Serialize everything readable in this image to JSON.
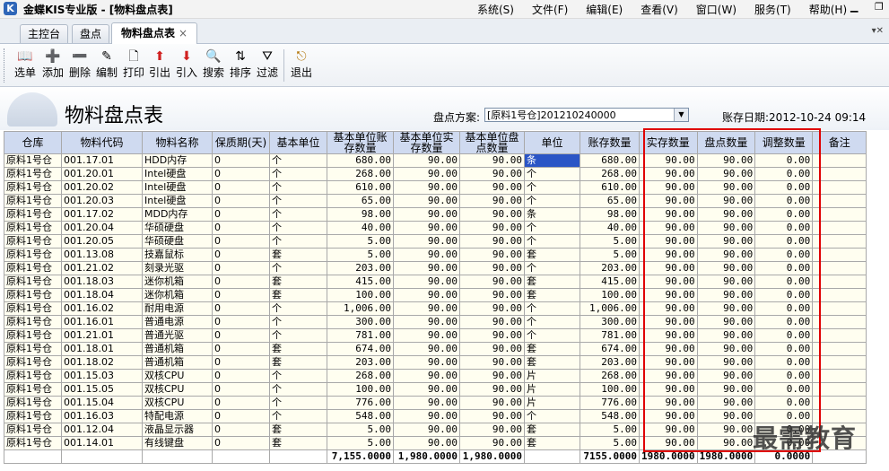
{
  "window": {
    "title": "金蝶KIS专业版 - [物料盘点表]",
    "logo": "K"
  },
  "menu": [
    "系统(S)",
    "文件(F)",
    "编辑(E)",
    "查看(V)",
    "窗口(W)",
    "服务(T)",
    "帮助(H)"
  ],
  "tabs": [
    {
      "label": "主控台"
    },
    {
      "label": "盘点"
    },
    {
      "label": "物料盘点表",
      "close": "×"
    }
  ],
  "toolbar": [
    {
      "label": "选单",
      "icon": "book-icon",
      "glyph": "📖"
    },
    {
      "label": "添加",
      "icon": "add-icon",
      "glyph": "➕"
    },
    {
      "label": "删除",
      "icon": "delete-icon",
      "glyph": "➖"
    },
    {
      "label": "编制",
      "icon": "edit-icon",
      "glyph": "✎"
    },
    {
      "label": "打印",
      "icon": "print-icon",
      "glyph": "🗋"
    },
    {
      "label": "引出",
      "icon": "export-icon",
      "glyph": "⬆"
    },
    {
      "label": "引入",
      "icon": "import-icon",
      "glyph": "⬇"
    },
    {
      "label": "搜索",
      "icon": "search-icon",
      "glyph": "🔍"
    },
    {
      "label": "排序",
      "icon": "sort-icon",
      "glyph": "⇅"
    },
    {
      "label": "过滤",
      "icon": "filter-icon",
      "glyph": "⛛"
    },
    {
      "label": "退出",
      "icon": "exit-icon",
      "glyph": "⎋"
    }
  ],
  "page": {
    "title": "物料盘点表",
    "plan_label": "盘点方案:",
    "plan_value": "[原料1号仓]201210240000",
    "date_label": "账存日期:",
    "date_value": "2012-10-24 09:14"
  },
  "table": {
    "headers": [
      "仓库",
      "物料代码",
      "物料名称",
      "保质期(天)",
      "基本单位",
      "基本单位账存数量",
      "基本单位实存数量",
      "基本单位盘点数量",
      "单位",
      "账存数量",
      "实存数量",
      "盘点数量",
      "调整数量",
      "备注"
    ],
    "rows": [
      [
        "原料1号仓",
        "001.17.01",
        "HDD内存",
        "0",
        "个",
        "680.00",
        "90.00",
        "90.00",
        "条",
        "680.00",
        "90.00",
        "90.00",
        "0.00",
        ""
      ],
      [
        "原料1号仓",
        "001.20.01",
        "Intel硬盘",
        "0",
        "个",
        "268.00",
        "90.00",
        "90.00",
        "个",
        "268.00",
        "90.00",
        "90.00",
        "0.00",
        ""
      ],
      [
        "原料1号仓",
        "001.20.02",
        "Intel硬盘",
        "0",
        "个",
        "610.00",
        "90.00",
        "90.00",
        "个",
        "610.00",
        "90.00",
        "90.00",
        "0.00",
        ""
      ],
      [
        "原料1号仓",
        "001.20.03",
        "Intel硬盘",
        "0",
        "个",
        "65.00",
        "90.00",
        "90.00",
        "个",
        "65.00",
        "90.00",
        "90.00",
        "0.00",
        ""
      ],
      [
        "原料1号仓",
        "001.17.02",
        "MDD内存",
        "0",
        "个",
        "98.00",
        "90.00",
        "90.00",
        "条",
        "98.00",
        "90.00",
        "90.00",
        "0.00",
        ""
      ],
      [
        "原料1号仓",
        "001.20.04",
        "华硕硬盘",
        "0",
        "个",
        "40.00",
        "90.00",
        "90.00",
        "个",
        "40.00",
        "90.00",
        "90.00",
        "0.00",
        ""
      ],
      [
        "原料1号仓",
        "001.20.05",
        "华硕硬盘",
        "0",
        "个",
        "5.00",
        "90.00",
        "90.00",
        "个",
        "5.00",
        "90.00",
        "90.00",
        "0.00",
        ""
      ],
      [
        "原料1号仓",
        "001.13.08",
        "技嘉鼠标",
        "0",
        "套",
        "5.00",
        "90.00",
        "90.00",
        "套",
        "5.00",
        "90.00",
        "90.00",
        "0.00",
        ""
      ],
      [
        "原料1号仓",
        "001.21.02",
        "刻录光驱",
        "0",
        "个",
        "203.00",
        "90.00",
        "90.00",
        "个",
        "203.00",
        "90.00",
        "90.00",
        "0.00",
        ""
      ],
      [
        "原料1号仓",
        "001.18.03",
        "迷你机箱",
        "0",
        "套",
        "415.00",
        "90.00",
        "90.00",
        "套",
        "415.00",
        "90.00",
        "90.00",
        "0.00",
        ""
      ],
      [
        "原料1号仓",
        "001.18.04",
        "迷你机箱",
        "0",
        "套",
        "100.00",
        "90.00",
        "90.00",
        "套",
        "100.00",
        "90.00",
        "90.00",
        "0.00",
        ""
      ],
      [
        "原料1号仓",
        "001.16.02",
        "耐用电源",
        "0",
        "个",
        "1,006.00",
        "90.00",
        "90.00",
        "个",
        "1,006.00",
        "90.00",
        "90.00",
        "0.00",
        ""
      ],
      [
        "原料1号仓",
        "001.16.01",
        "普通电源",
        "0",
        "个",
        "300.00",
        "90.00",
        "90.00",
        "个",
        "300.00",
        "90.00",
        "90.00",
        "0.00",
        ""
      ],
      [
        "原料1号仓",
        "001.21.01",
        "普通光驱",
        "0",
        "个",
        "781.00",
        "90.00",
        "90.00",
        "个",
        "781.00",
        "90.00",
        "90.00",
        "0.00",
        ""
      ],
      [
        "原料1号仓",
        "001.18.01",
        "普通机箱",
        "0",
        "套",
        "674.00",
        "90.00",
        "90.00",
        "套",
        "674.00",
        "90.00",
        "90.00",
        "0.00",
        ""
      ],
      [
        "原料1号仓",
        "001.18.02",
        "普通机箱",
        "0",
        "套",
        "203.00",
        "90.00",
        "90.00",
        "套",
        "203.00",
        "90.00",
        "90.00",
        "0.00",
        ""
      ],
      [
        "原料1号仓",
        "001.15.03",
        "双核CPU",
        "0",
        "个",
        "268.00",
        "90.00",
        "90.00",
        "片",
        "268.00",
        "90.00",
        "90.00",
        "0.00",
        ""
      ],
      [
        "原料1号仓",
        "001.15.05",
        "双核CPU",
        "0",
        "个",
        "100.00",
        "90.00",
        "90.00",
        "片",
        "100.00",
        "90.00",
        "90.00",
        "0.00",
        ""
      ],
      [
        "原料1号仓",
        "001.15.04",
        "双核CPU",
        "0",
        "个",
        "776.00",
        "90.00",
        "90.00",
        "片",
        "776.00",
        "90.00",
        "90.00",
        "0.00",
        ""
      ],
      [
        "原料1号仓",
        "001.16.03",
        "特配电源",
        "0",
        "个",
        "548.00",
        "90.00",
        "90.00",
        "个",
        "548.00",
        "90.00",
        "90.00",
        "0.00",
        ""
      ],
      [
        "原料1号仓",
        "001.12.04",
        "液晶显示器",
        "0",
        "套",
        "5.00",
        "90.00",
        "90.00",
        "套",
        "5.00",
        "90.00",
        "90.00",
        "0.00",
        ""
      ],
      [
        "原料1号仓",
        "001.14.01",
        "有线键盘",
        "0",
        "套",
        "5.00",
        "90.00",
        "90.00",
        "套",
        "5.00",
        "90.00",
        "90.00",
        "0.00",
        ""
      ]
    ],
    "totals": [
      "",
      "",
      "",
      "",
      "",
      "7,155.0000",
      "1,980.0000",
      "1,980.0000",
      "",
      "7155.0000",
      "1980.0000",
      "1980.0000",
      "0.0000",
      ""
    ]
  },
  "watermark": "最需教育",
  "colors": {
    "header_bg": "#cfdaf0",
    "row_bg": "#fffef0",
    "highlight_box": "#e00000",
    "selected_cell": "#2a55c6"
  }
}
